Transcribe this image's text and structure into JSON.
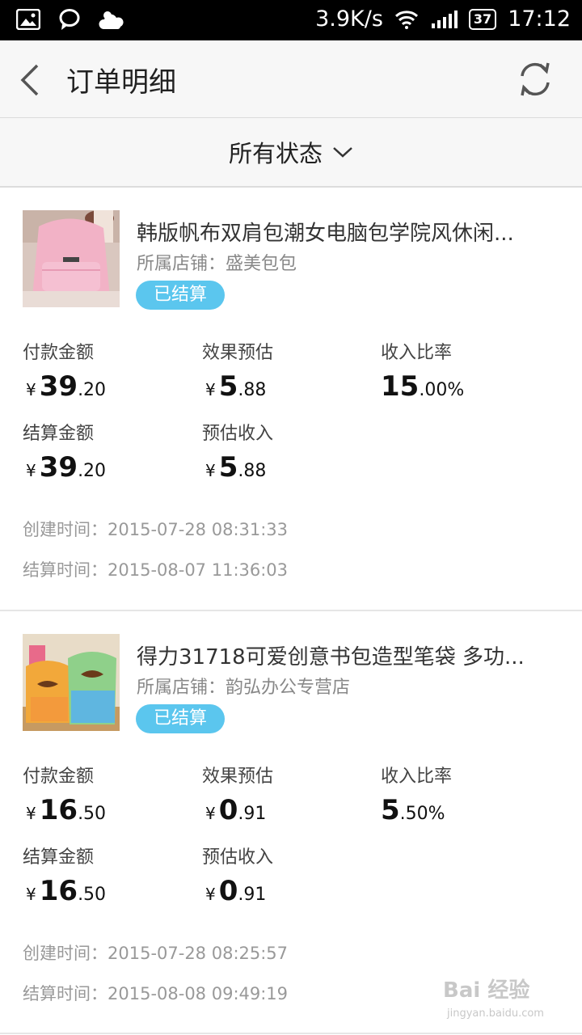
{
  "status_bar": {
    "speed": "3.9K/s",
    "battery": "37",
    "time": "17:12",
    "icons": [
      "image-icon",
      "chat-bubble-icon",
      "cloud-icon",
      "wifi-icon",
      "signal-icon",
      "battery-icon"
    ]
  },
  "header": {
    "title": "订单明细",
    "back_icon": "back-arrow-icon",
    "refresh_icon": "refresh-icon"
  },
  "filter": {
    "label": "所有状态",
    "icon": "chevron-down-icon"
  },
  "labels": {
    "paid": "付款金额",
    "effect": "效果预估",
    "rate": "收入比率",
    "settled": "结算金额",
    "est_income": "预估收入",
    "currency": "¥",
    "percent": "%"
  },
  "orders": [
    {
      "title": "韩版帆布双肩包潮女电脑包学院风休闲...",
      "shop": "所属店铺：盛美包包",
      "status": "已结算",
      "paid_int": "39",
      "paid_dec": ".20",
      "effect_int": "5",
      "effect_dec": ".88",
      "rate_int": "15",
      "rate_dec": ".00",
      "settled_int": "39",
      "settled_dec": ".20",
      "income_int": "5",
      "income_dec": ".88",
      "created": "创建时间：2015-07-28 08:31:33",
      "settled_time": "结算时间：2015-08-07 11:36:03"
    },
    {
      "title": "得力31718可爱创意书包造型笔袋 多功...",
      "shop": "所属店铺：韵弘办公专营店",
      "status": "已结算",
      "paid_int": "16",
      "paid_dec": ".50",
      "effect_int": "0",
      "effect_dec": ".91",
      "rate_int": "5",
      "rate_dec": ".50",
      "settled_int": "16",
      "settled_dec": ".50",
      "income_int": "0",
      "income_dec": ".91",
      "created": "创建时间：2015-07-28 08:25:57",
      "settled_time": "结算时间：2015-08-08 09:49:19"
    }
  ],
  "watermark": {
    "main": "Bai 经验",
    "sub": "jingyan.baidu.com"
  }
}
